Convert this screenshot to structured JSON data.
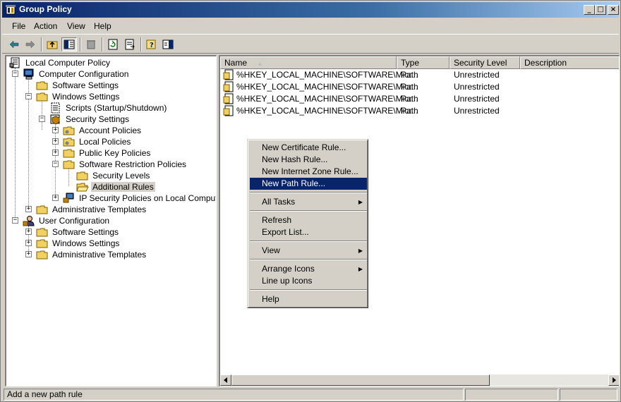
{
  "window": {
    "title": "Group Policy"
  },
  "menubar": {
    "items": [
      "File",
      "Action",
      "View",
      "Help"
    ]
  },
  "toolbar": {
    "buttons": [
      "back-icon",
      "forward-icon",
      "up-folder-icon",
      "show-hide-tree-icon",
      "delete-icon",
      "refresh-icon",
      "export-list-icon",
      "help-icon",
      "console-icon"
    ]
  },
  "tree": {
    "items": [
      {
        "label": "Local Computer Policy",
        "icon": "policy-icon"
      },
      {
        "label": "Computer Configuration",
        "icon": "computer-icon"
      },
      {
        "label": "Software Settings",
        "icon": "folder-icon"
      },
      {
        "label": "Windows Settings",
        "icon": "folder-icon"
      },
      {
        "label": "Scripts (Startup/Shutdown)",
        "icon": "script-icon"
      },
      {
        "label": "Security Settings",
        "icon": "security-icon"
      },
      {
        "label": "Account Policies",
        "icon": "folder-icon"
      },
      {
        "label": "Local Policies",
        "icon": "folder-icon"
      },
      {
        "label": "Public Key Policies",
        "icon": "folder-icon"
      },
      {
        "label": "Software Restriction Policies",
        "icon": "folder-icon"
      },
      {
        "label": "Security Levels",
        "icon": "folder-icon"
      },
      {
        "label": "Additional Rules",
        "icon": "open-folder-icon"
      },
      {
        "label": "IP Security Policies on Local Computer",
        "icon": "network-icon"
      },
      {
        "label": "Administrative Templates",
        "icon": "folder-icon"
      },
      {
        "label": "User Configuration",
        "icon": "user-icon"
      },
      {
        "label": "Software Settings",
        "icon": "folder-icon"
      },
      {
        "label": "Windows Settings",
        "icon": "folder-icon"
      },
      {
        "label": "Administrative Templates",
        "icon": "folder-icon"
      }
    ],
    "selected": "Additional Rules"
  },
  "list": {
    "columns": [
      "Name",
      "Type",
      "Security Level",
      "Description"
    ],
    "rows": [
      {
        "name": "%HKEY_LOCAL_MACHINE\\SOFTWARE\\Micr...",
        "type": "Path",
        "level": "Unrestricted",
        "description": ""
      },
      {
        "name": "%HKEY_LOCAL_MACHINE\\SOFTWARE\\Micr...",
        "type": "Path",
        "level": "Unrestricted",
        "description": ""
      },
      {
        "name": "%HKEY_LOCAL_MACHINE\\SOFTWARE\\Micr...",
        "type": "Path",
        "level": "Unrestricted",
        "description": ""
      },
      {
        "name": "%HKEY_LOCAL_MACHINE\\SOFTWARE\\Micr...",
        "type": "Path",
        "level": "Unrestricted",
        "description": ""
      }
    ]
  },
  "context_menu": {
    "items": [
      "New Certificate Rule...",
      "New Hash Rule...",
      "New Internet Zone Rule...",
      "New Path Rule...",
      "All Tasks",
      "Refresh",
      "Export List...",
      "View",
      "Arrange Icons",
      "Line up Icons",
      "Help"
    ],
    "highlighted": "New Path Rule..."
  },
  "statusbar": {
    "text": "Add a new path rule"
  },
  "colors": {
    "title_bar": "#0a246a",
    "highlight": "#0a246a",
    "face": "#d4d0c8"
  }
}
